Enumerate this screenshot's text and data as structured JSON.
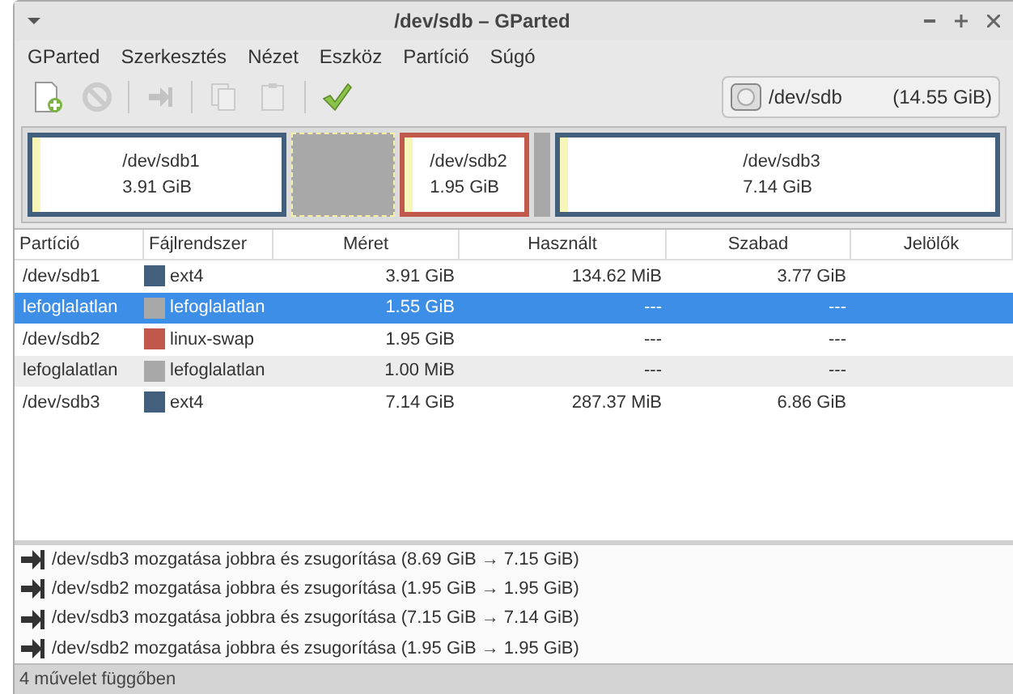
{
  "window": {
    "title": "/dev/sdb – GParted"
  },
  "menu": [
    "GParted",
    "Szerkesztés",
    "Nézet",
    "Eszköz",
    "Partíció",
    "Súgó"
  ],
  "toolbar": [
    {
      "kind": "new",
      "disabled": false
    },
    {
      "kind": "delete",
      "disabled": true
    },
    {
      "kind": "resize",
      "disabled": true
    },
    {
      "kind": "copy",
      "disabled": true
    },
    {
      "kind": "paste",
      "disabled": true
    },
    {
      "kind": "apply",
      "disabled": false
    }
  ],
  "device": {
    "name": "/dev/sdb",
    "size": "(14.55 GiB)"
  },
  "map": [
    {
      "kind": "partition",
      "name": "/dev/sdb1",
      "size": "3.91 GiB",
      "color": "#42607e"
    },
    {
      "kind": "unallocated"
    },
    {
      "kind": "partition",
      "name": "/dev/sdb2",
      "size": "1.95 GiB",
      "color": "#c0584b"
    },
    {
      "kind": "unallocated"
    },
    {
      "kind": "partition",
      "name": "/dev/sdb3",
      "size": "7.14 GiB",
      "color": "#42607e"
    }
  ],
  "table": {
    "columns": [
      "Partíció",
      "Fájlrendszer",
      "Méret",
      "Használt",
      "Szabad",
      "Jelölők"
    ],
    "rows": [
      {
        "partition": "/dev/sdb1",
        "filesystem": "ext4",
        "color": "#42607e",
        "size": "3.91 GiB",
        "used": "134.62 MiB",
        "free": "3.77 GiB",
        "selected": false
      },
      {
        "partition": "lefoglalatlan",
        "filesystem": "lefoglalatlan",
        "color": "#a8a8a8",
        "size": "1.55 GiB",
        "used": "---",
        "free": "---",
        "selected": true
      },
      {
        "partition": "/dev/sdb2",
        "filesystem": "linux-swap",
        "color": "#c0584b",
        "size": "1.95 GiB",
        "used": "---",
        "free": "---",
        "selected": false
      },
      {
        "partition": "lefoglalatlan",
        "filesystem": "lefoglalatlan",
        "color": "#a8a8a8",
        "size": "1.00 MiB",
        "used": "---",
        "free": "---",
        "selected": false
      },
      {
        "partition": "/dev/sdb3",
        "filesystem": "ext4",
        "color": "#42607e",
        "size": "7.14 GiB",
        "used": "287.37 MiB",
        "free": "6.86 GiB",
        "selected": false
      }
    ]
  },
  "operations": [
    "/dev/sdb3 mozgatása jobbra és zsugorítása (8.69 GiB → 7.15 GiB)",
    "/dev/sdb2 mozgatása jobbra és zsugorítása (1.95 GiB → 1.95 GiB)",
    "/dev/sdb3 mozgatása jobbra és zsugorítása (7.15 GiB → 7.14 GiB)",
    "/dev/sdb2 mozgatása jobbra és zsugorítása (1.95 GiB → 1.95 GiB)"
  ],
  "status_bar": "4 művelet függőben"
}
